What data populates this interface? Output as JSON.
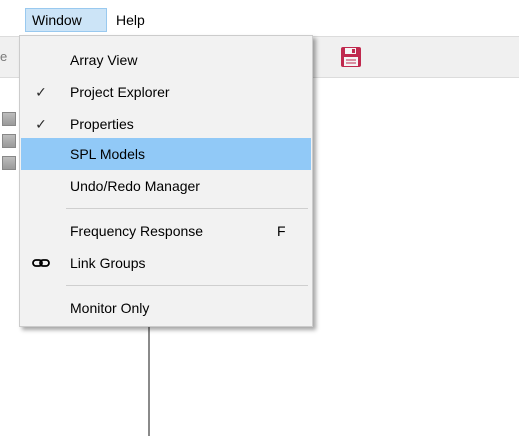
{
  "menubar": {
    "window_label": "Window",
    "help_label": "Help"
  },
  "toolbar": {
    "cut_text": "e"
  },
  "window_menu": {
    "items": [
      {
        "label": "Array View",
        "checked": false
      },
      {
        "label": "Project Explorer",
        "checked": true,
        "check_glyph": "✓"
      },
      {
        "label": "Properties",
        "checked": true,
        "check_glyph": "✓"
      },
      {
        "label": "SPL Models",
        "checked": false,
        "highlighted": true
      },
      {
        "label": "Undo/Redo Manager",
        "checked": false
      },
      {
        "label": "Frequency Response",
        "shortcut": "F"
      },
      {
        "label": "Link Groups",
        "icon": "link-icon"
      },
      {
        "label": "Monitor Only"
      }
    ]
  },
  "colors": {
    "highlight": "#91c9f7",
    "menubar_active": "#cce4f7",
    "save_icon": "#c0294e"
  }
}
